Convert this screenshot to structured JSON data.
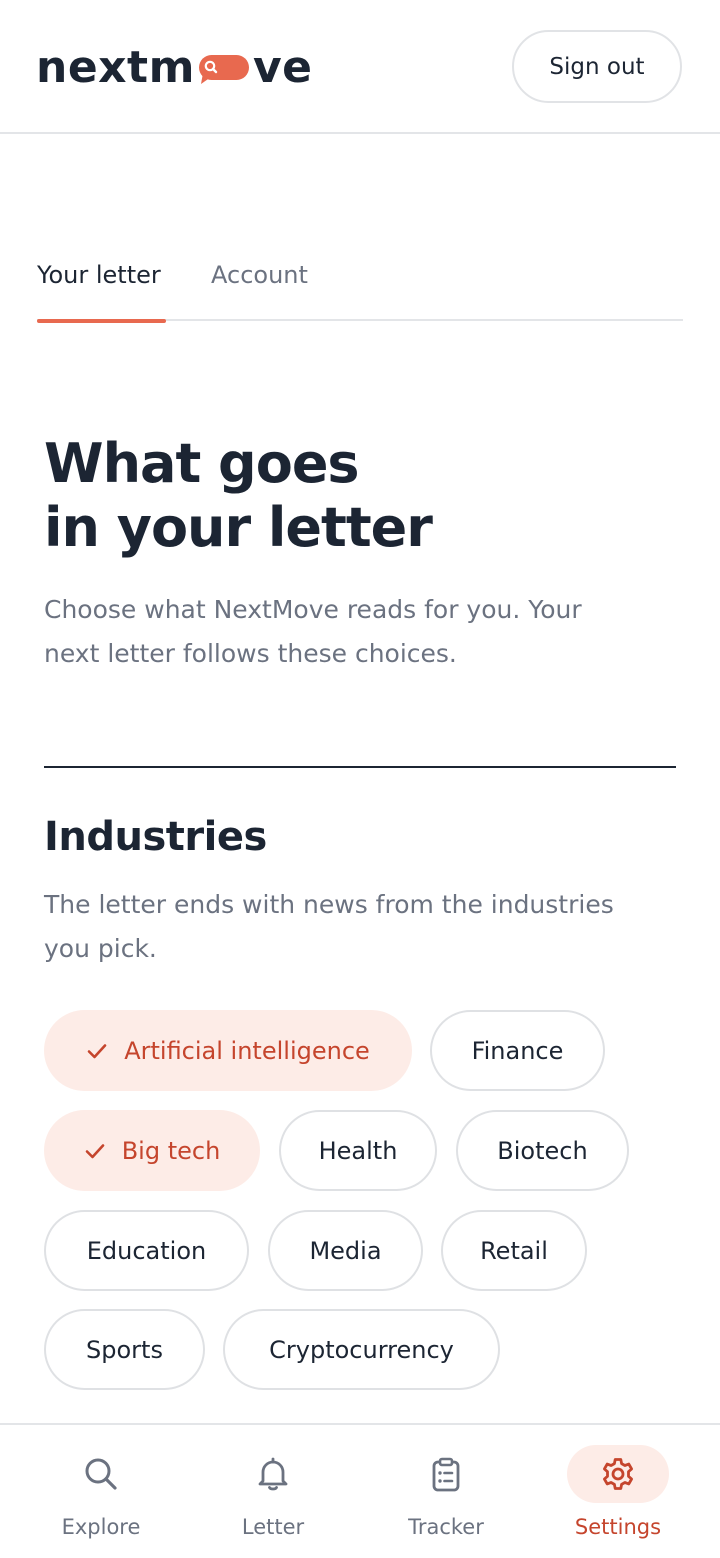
{
  "brand": {
    "name_part1": "nextm",
    "name_part2": "ve",
    "accent_color": "#e8694f",
    "dark_color": "#1c2533"
  },
  "header": {
    "signout_label": "Sign out"
  },
  "tabs": [
    {
      "label": "Your letter",
      "active": true
    },
    {
      "label": "Account",
      "active": false
    }
  ],
  "hero": {
    "title_line1": "What goes",
    "title_line2": "in your letter",
    "subtitle_line1": "Choose what NextMove reads for you. Your",
    "subtitle_line2": "next letter follows these choices."
  },
  "industries": {
    "title": "Industries",
    "subtitle_line1": "The letter ends with news from the industries",
    "subtitle_line2": "you pick.",
    "chips": [
      {
        "label": "Artificial intelligence",
        "selected": true
      },
      {
        "label": "Finance",
        "selected": false
      },
      {
        "label": "Big tech",
        "selected": true
      },
      {
        "label": "Health",
        "selected": false
      },
      {
        "label": "Biotech",
        "selected": false
      },
      {
        "label": "Education",
        "selected": false
      },
      {
        "label": "Media",
        "selected": false
      },
      {
        "label": "Retail",
        "selected": false
      },
      {
        "label": "Sports",
        "selected": false
      },
      {
        "label": "Cryptocurrency",
        "selected": false
      }
    ]
  },
  "bottom_nav": [
    {
      "label": "Explore",
      "icon": "search-icon",
      "active": false
    },
    {
      "label": "Letter",
      "icon": "bell-icon",
      "active": false
    },
    {
      "label": "Tracker",
      "icon": "clipboard-icon",
      "active": false
    },
    {
      "label": "Settings",
      "icon": "gear-icon",
      "active": true
    }
  ]
}
